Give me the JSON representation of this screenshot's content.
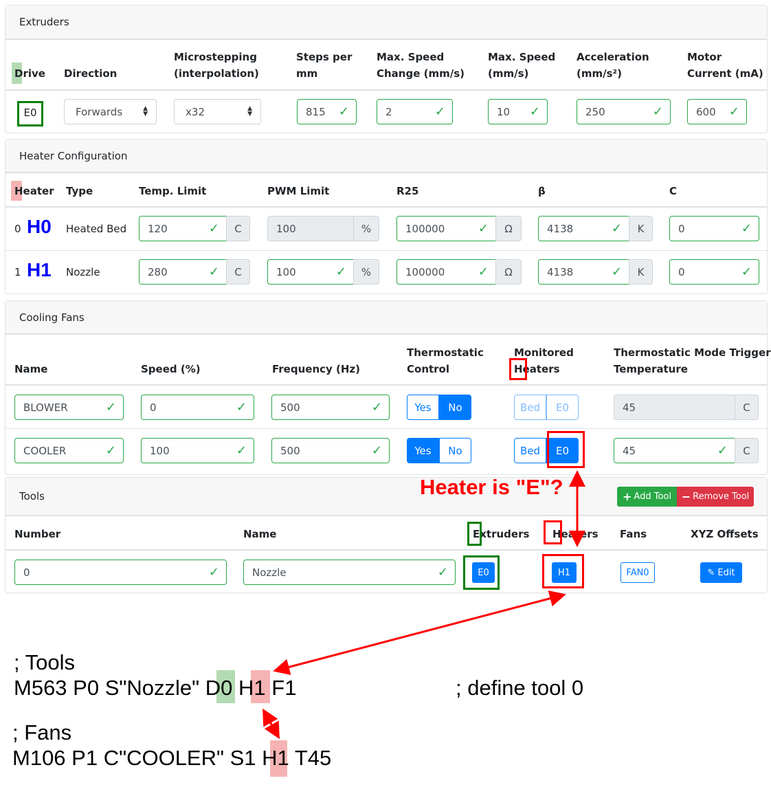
{
  "extruders": {
    "title": "Extruders",
    "headers": [
      "Drive",
      "Direction",
      "Microstepping\n(interpolation)",
      "Steps per\nmm",
      "Max. Speed\nChange (mm/s)",
      "Max. Speed\n(mm/s)",
      "Acceleration\n(mm/s²)",
      "Motor\nCurrent (mA)"
    ],
    "row": {
      "drive": "E0",
      "direction": "Forwards",
      "microstepping": "x32",
      "steps_per_mm": "815",
      "max_speed_change": "2",
      "max_speed": "10",
      "acceleration": "250",
      "motor_current": "600"
    }
  },
  "heaters": {
    "title": "Heater Configuration",
    "headers": [
      "Heater",
      "Type",
      "Temp. Limit",
      "PWM Limit",
      "R25",
      "β",
      "C"
    ],
    "rows": [
      {
        "index": "0",
        "label": "H0",
        "type": "Heated Bed",
        "temp_limit": "120",
        "temp_unit": "C",
        "pwm_limit": "100",
        "pwm_unit": "%",
        "r25": "100000",
        "r25_unit": "Ω",
        "beta": "4138",
        "beta_unit": "K",
        "c": "0"
      },
      {
        "index": "1",
        "label": "H1",
        "type": "Nozzle",
        "temp_limit": "280",
        "temp_unit": "C",
        "pwm_limit": "100",
        "pwm_unit": "%",
        "r25": "100000",
        "r25_unit": "Ω",
        "beta": "4138",
        "beta_unit": "K",
        "c": "0"
      }
    ]
  },
  "fans": {
    "title": "Cooling Fans",
    "headers": [
      "Name",
      "Speed (%)",
      "Frequency (Hz)",
      "Thermostatic\nControl",
      "Monitored\nHeaters",
      "Thermostatic Mode Trigger\nTemperature"
    ],
    "rows": [
      {
        "name": "BLOWER",
        "speed": "0",
        "frequency": "500",
        "yes": "Yes",
        "no": "No",
        "thermostatic": "No",
        "bed": "Bed",
        "e0": "E0",
        "trigger": "45",
        "unit": "C"
      },
      {
        "name": "COOLER",
        "speed": "100",
        "frequency": "500",
        "yes": "Yes",
        "no": "No",
        "thermostatic": "Yes",
        "bed": "Bed",
        "e0": "E0",
        "trigger": "45",
        "unit": "C"
      }
    ]
  },
  "tools": {
    "title": "Tools",
    "add_label": "Add Tool",
    "remove_label": "Remove Tool",
    "headers": [
      "Number",
      "Name",
      "Extruders",
      "Heaters",
      "Fans",
      "XYZ Offsets"
    ],
    "row": {
      "number": "0",
      "name": "Nozzle",
      "extruder": "E0",
      "heater": "H1",
      "fan": "FAN0",
      "edit": "Edit"
    }
  },
  "annotation": {
    "question": "Heater is \"E\"?",
    "colors": {
      "red": "#ff0000",
      "green": "#008000",
      "green_hl": "#b3dbb3",
      "pink_hl": "#f5b3b3"
    }
  },
  "code": {
    "tools_comment": "; Tools",
    "m563_pre": "M563 P0 S\"Nozzle\" ",
    "m563_d": "D0",
    "m563_h": "H1",
    "m563_post": " F1",
    "m563_comment": "; define tool 0",
    "fans_comment": "; Fans",
    "m106_pre": "M106 P1 C\"COOLER\" S1 ",
    "m106_h": "H1",
    "m106_post": " T45"
  }
}
